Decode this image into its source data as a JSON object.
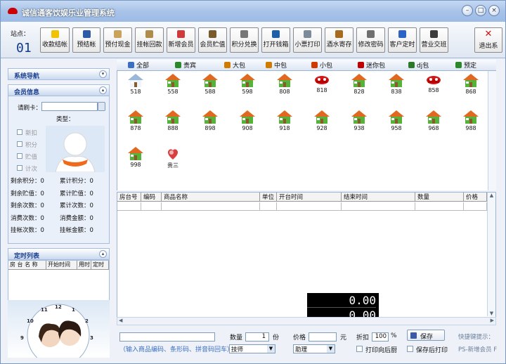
{
  "app": {
    "title": "诚信通客饮娱乐业管理系统"
  },
  "window_controls": {
    "minimize": "–",
    "maximize": "□",
    "close": "×"
  },
  "site": {
    "label": "站点：",
    "value": "01"
  },
  "toolbar": [
    {
      "name": "checkout-button",
      "label": "收款结帐",
      "color": "#f2c200",
      "icon": "coin-icon"
    },
    {
      "name": "pre-settle-button",
      "label": "预结帐",
      "color": "#2d5ba8",
      "icon": "calculator-icon"
    },
    {
      "name": "prepay-button",
      "label": "预付现金",
      "color": "#c9a35a",
      "icon": "receipt-icon"
    },
    {
      "name": "hang-account-button",
      "label": "挂帐回款",
      "color": "#b08c4a",
      "icon": "document-icon"
    },
    {
      "name": "new-member-button",
      "label": "新增会员",
      "color": "#d13a3a",
      "icon": "members-icon"
    },
    {
      "name": "member-deposit-button",
      "label": "会员贮值",
      "color": "#7a5a2a",
      "icon": "card-icon"
    },
    {
      "name": "points-exchange-button",
      "label": "积分兑换",
      "color": "#777777",
      "icon": "exchange-icon"
    },
    {
      "name": "open-cashbox-button",
      "label": "打开钱箱",
      "color": "#1f5fa8",
      "icon": "cashbox-icon"
    },
    {
      "name": "print-receipt-button",
      "label": "小票打印",
      "color": "#7d8a99",
      "icon": "printer-icon"
    },
    {
      "name": "wine-storage-button",
      "label": "酒水寄存",
      "color": "#a86a1c",
      "icon": "bottle-icon"
    },
    {
      "name": "change-password-button",
      "label": "修改密码",
      "color": "#6f6f6f",
      "icon": "key-icon"
    },
    {
      "name": "customer-timer-button",
      "label": "客户定时",
      "color": "#2b64c6",
      "icon": "clock-icon"
    },
    {
      "name": "shift-handover-button",
      "label": "营业交班",
      "color": "#3c3c3c",
      "icon": "people-icon"
    },
    {
      "name": "exit-button",
      "label": "退出系",
      "color": "#d01010",
      "icon": "close-x-icon"
    }
  ],
  "left": {
    "nav_title": "系统导航",
    "member_title": "会员信息",
    "card_label": "请刷卡：",
    "type_label": "类型：",
    "checks": [
      "新扣",
      "积分",
      "贮值",
      "计次"
    ],
    "stats": [
      {
        "a": "剩余积分：0",
        "b": "累计积分：0"
      },
      {
        "a": "剩余贮值：0",
        "b": "累计贮值：0"
      },
      {
        "a": "剩余次数：0",
        "b": "累计次数：0"
      },
      {
        "a": "消费次数：0",
        "b": "消费金额：0"
      },
      {
        "a": "挂帐次数：0",
        "b": "挂帐金额：0"
      }
    ],
    "timer_title": "定时列表",
    "timer_cols": [
      "房 台 名 称",
      "开始时间",
      "用时",
      "定时"
    ],
    "clock_numbers": [
      "12",
      "11",
      "1",
      "10",
      "2",
      "9",
      "3"
    ]
  },
  "tabs": [
    {
      "name": "tab-all",
      "label": "全部",
      "color": "#3a6fc4"
    },
    {
      "name": "tab-vip",
      "label": "贵宾",
      "color": "#2a8a2a"
    },
    {
      "name": "tab-large",
      "label": "大包",
      "color": "#d07a00"
    },
    {
      "name": "tab-medium",
      "label": "中包",
      "color": "#d07a00"
    },
    {
      "name": "tab-small",
      "label": "小包",
      "color": "#d03a00"
    },
    {
      "name": "tab-mini",
      "label": "迷你包",
      "color": "#c00000"
    },
    {
      "name": "tab-dj",
      "label": "dj包",
      "color": "#2a7a2a"
    },
    {
      "name": "tab-reserve",
      "label": "预定",
      "color": "#2a8a2a"
    }
  ],
  "rooms": [
    {
      "label": "518",
      "status": "white"
    },
    {
      "label": "558",
      "status": "green"
    },
    {
      "label": "588",
      "status": "green"
    },
    {
      "label": "598",
      "status": "green"
    },
    {
      "label": "808",
      "status": "green"
    },
    {
      "label": "818",
      "status": "red"
    },
    {
      "label": "828",
      "status": "green"
    },
    {
      "label": "838",
      "status": "green"
    },
    {
      "label": "858",
      "status": "red"
    },
    {
      "label": "868",
      "status": "green"
    },
    {
      "label": "878",
      "status": "green"
    },
    {
      "label": "888",
      "status": "green"
    },
    {
      "label": "898",
      "status": "green"
    },
    {
      "label": "908",
      "status": "green"
    },
    {
      "label": "918",
      "status": "green"
    },
    {
      "label": "928",
      "status": "green"
    },
    {
      "label": "938",
      "status": "green"
    },
    {
      "label": "958",
      "status": "green"
    },
    {
      "label": "968",
      "status": "green"
    },
    {
      "label": "988",
      "status": "green"
    },
    {
      "label": "998",
      "status": "green"
    },
    {
      "label": "贵三",
      "status": "special"
    }
  ],
  "table": {
    "columns": [
      "房台号",
      "编码",
      "商品名称",
      "单位",
      "开台时间",
      "结束时间",
      "数量",
      "价格"
    ]
  },
  "totals": {
    "amount1": "0.00",
    "amount2": "0.00"
  },
  "bottom": {
    "search_hint": "（输入商品编码、条形码、拼音码回车）",
    "qty_label": "数量",
    "qty_value": "1",
    "qty_unit": "份",
    "price_label": "价格",
    "price_unit": "元",
    "discount_label": "折扣",
    "discount_value": "100",
    "discount_unit": "%",
    "save_label": "保存",
    "technician_value": "技师",
    "assistant_value": "助理",
    "print_after_label": "打印向后厨",
    "save_print_label": "保存后打印",
    "shortcut_label": "快捷键提示：",
    "shortcut_hint": "PS-新增会员 F"
  }
}
